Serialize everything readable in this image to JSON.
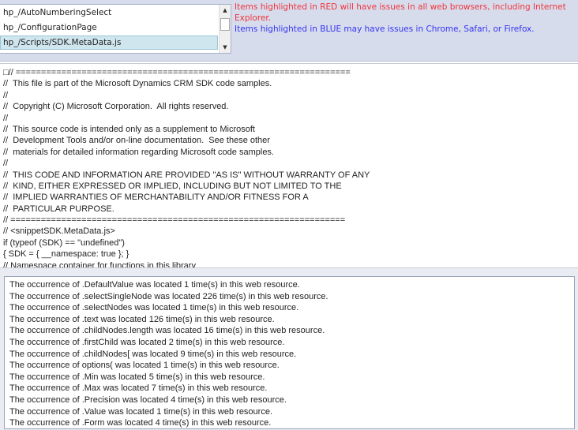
{
  "resource_list": {
    "items": [
      "hp_/AutoNumberingSelect",
      "hp_/ConfigurationPage",
      "hp_/Scripts/SDK.MetaData.js"
    ],
    "selected_index": 2
  },
  "legend": {
    "red_text": "Items highlighted in RED will have issues in all web browsers, including Internet Explorer.",
    "blue_text": "Items highlighted in BLUE may have issues in Chrome, Safari, or Firefox.",
    "red_color": "#f0333a",
    "blue_color": "#3535ee"
  },
  "code_lines": [
    "□// ==================================================================",
    "//  This file is part of the Microsoft Dynamics CRM SDK code samples.",
    "//",
    "//  Copyright (C) Microsoft Corporation.  All rights reserved.",
    "//",
    "//  This source code is intended only as a supplement to Microsoft",
    "//  Development Tools and/or on-line documentation.  See these other",
    "//  materials for detailed information regarding Microsoft code samples.",
    "//",
    "//  THIS CODE AND INFORMATION ARE PROVIDED \"AS IS\" WITHOUT WARRANTY OF ANY",
    "//  KIND, EITHER EXPRESSED OR IMPLIED, INCLUDING BUT NOT LIMITED TO THE",
    "//  IMPLIED WARRANTIES OF MERCHANTABILITY AND/OR FITNESS FOR A",
    "//  PARTICULAR PURPOSE.",
    "// ==================================================================",
    "// <snippetSDK.MetaData.js>",
    "if (typeof (SDK) == \"undefined\")",
    "{ SDK = { __namespace: true }; }",
    "// Namespace container for functions in this library"
  ],
  "results": [
    "The occurrence of .DefaultValue was located 1 time(s) in this web resource.",
    "The occurrence of .selectSingleNode was located 226 time(s) in this web resource.",
    "The occurrence of .selectNodes was located 1 time(s) in this web resource.",
    "The occurrence of .text was located 126 time(s) in this web resource.",
    "The occurrence of .childNodes.length was located 16 time(s) in this web resource.",
    "The occurrence of .firstChild was located 2 time(s) in this web resource.",
    "The occurrence of .childNodes[ was located 9 time(s) in this web resource.",
    "The occurrence of options( was located 1 time(s) in this web resource.",
    "The occurrence of .Min was located 5 time(s) in this web resource.",
    "The occurrence of .Max was located 7 time(s) in this web resource.",
    "The occurrence of .Precision was located 4 time(s) in this web resource.",
    "The occurrence of .Value was located 1 time(s) in this web resource.",
    "The occurrence of .Form was located 4 time(s) in this web resource."
  ]
}
